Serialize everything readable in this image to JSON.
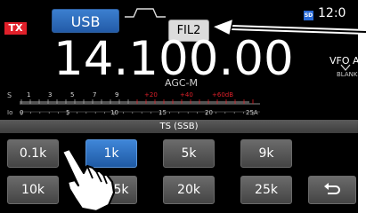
{
  "status": {
    "tx": "TX",
    "mode": "USB",
    "filter": "FIL2",
    "sd_badge": "SD",
    "clock": "12:0"
  },
  "frequency": {
    "display": "14.100.00",
    "agc": "AGC-M",
    "vfo": "VFO A",
    "blank_tag": "BLANK"
  },
  "meter": {
    "s_label": "S",
    "s_ticks": [
      "1",
      "3",
      "5",
      "7",
      "9",
      "+20",
      "+40",
      "+60dB"
    ],
    "id_label": "Io",
    "id_ticks": [
      "0",
      "5",
      "10",
      "15",
      "20",
      "25A"
    ]
  },
  "tuning_step": {
    "header": "TS (SSB)",
    "options": [
      "0.1k",
      "1k",
      "5k",
      "9k",
      "10k",
      "5k",
      "20k",
      "25k"
    ],
    "selected": "1k",
    "back_icon": "return-arrow-icon"
  },
  "colors": {
    "tx": "#e0202a",
    "selected": "#2f73c4",
    "meter_red": "#e0202a"
  }
}
